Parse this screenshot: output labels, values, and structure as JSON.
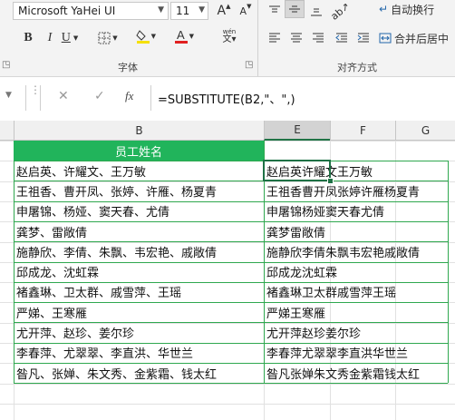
{
  "ribbon": {
    "font_name": "Microsoft YaHei UI",
    "font_size": "11",
    "increase_font": "A",
    "decrease_font": "A",
    "wrap_text_label": "自动换行",
    "merge_label": "合并后居中",
    "font_group_label": "字体",
    "align_group_label": "对齐方式",
    "phonetic_label": "wén",
    "bold": "B",
    "italic": "I",
    "underline": "U"
  },
  "formula_bar": {
    "fx": "fx",
    "formula": "=SUBSTITUTE(B2,\"、\",)"
  },
  "columns": {
    "B": "B",
    "E": "E",
    "F": "F",
    "G": "G"
  },
  "table": {
    "header": "员工姓名",
    "names": [
      "赵启英、许耀文、王万敏",
      "王祖香、曹开凤、张婷、许雁、杨夏青",
      "申屠锦、杨娅、窦天春、尤倩",
      "龚梦、雷敞倩",
      "施静欣、李倩、朱飘、韦宏艳、戚敞倩",
      "邱成龙、沈虹霖",
      "褚鑫琳、卫太群、戚雪萍、王瑶",
      "严娣、王寒雁",
      "尤开萍、赵珍、姜尔珍",
      "李春萍、尤翠翠、李直洪、华世兰",
      "昝凡、张婵、朱文秀、金紫霜、钱太红"
    ],
    "results": [
      "赵启英许耀文王万敏",
      "王祖香曹开凤张婷许雁杨夏青",
      "申屠锦杨娅窦天春尤倩",
      "龚梦雷敞倩",
      "施静欣李倩朱飘韦宏艳戚敞倩",
      "邱成龙沈虹霖",
      "褚鑫琳卫太群戚雪萍王瑶",
      "严娣王寒雁",
      "尤开萍赵珍姜尔珍",
      "李春萍尤翠翠李直洪华世兰",
      "昝凡张婵朱文秀金紫霜钱太红"
    ]
  },
  "colors": {
    "header_green": "#21b45b",
    "table_border": "#2fa84f",
    "ribbon_bg": "#f3f3f3",
    "font_color_red": "#e02020",
    "highlight_yellow": "#f5e000",
    "selected_cell_border": "#1e7145"
  },
  "icons": {
    "borders": "borders-icon",
    "fill": "fill-color-icon",
    "font_color": "font-color-icon",
    "wrap": "wrap-text-icon",
    "merge": "merge-center-icon",
    "cancel": "cancel-icon",
    "enter": "enter-check-icon",
    "launcher": "dialog-launcher-icon"
  }
}
